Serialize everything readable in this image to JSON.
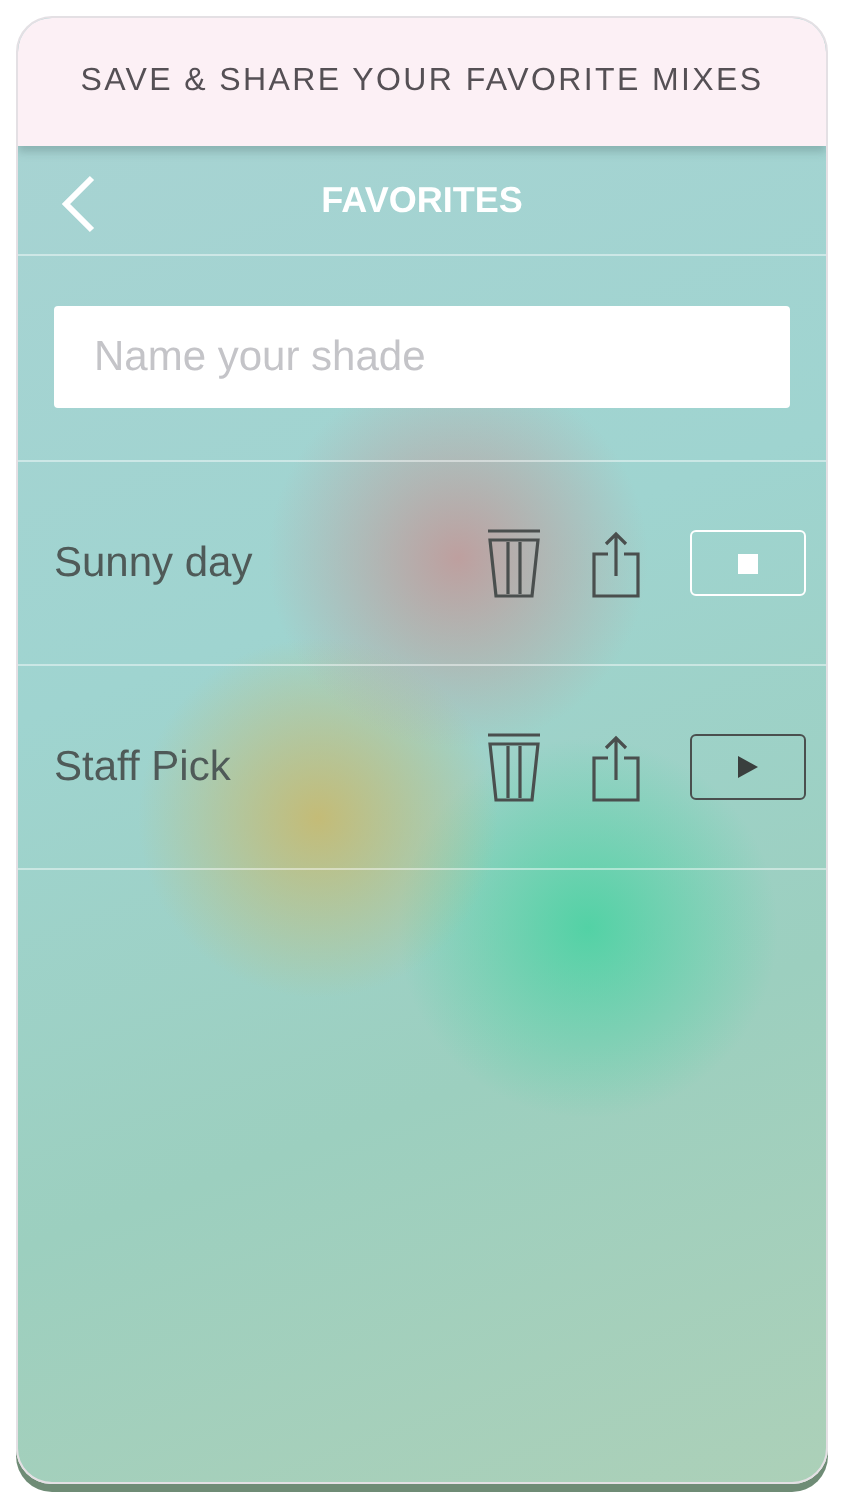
{
  "banner": {
    "title": "SAVE & SHARE YOUR FAVORITE MIXES"
  },
  "nav": {
    "title": "FAVORITES"
  },
  "name_field": {
    "placeholder": "Name your shade"
  },
  "favorites": [
    {
      "name": "Sunny day",
      "playing": true
    },
    {
      "name": "Staff Pick",
      "playing": false
    }
  ]
}
